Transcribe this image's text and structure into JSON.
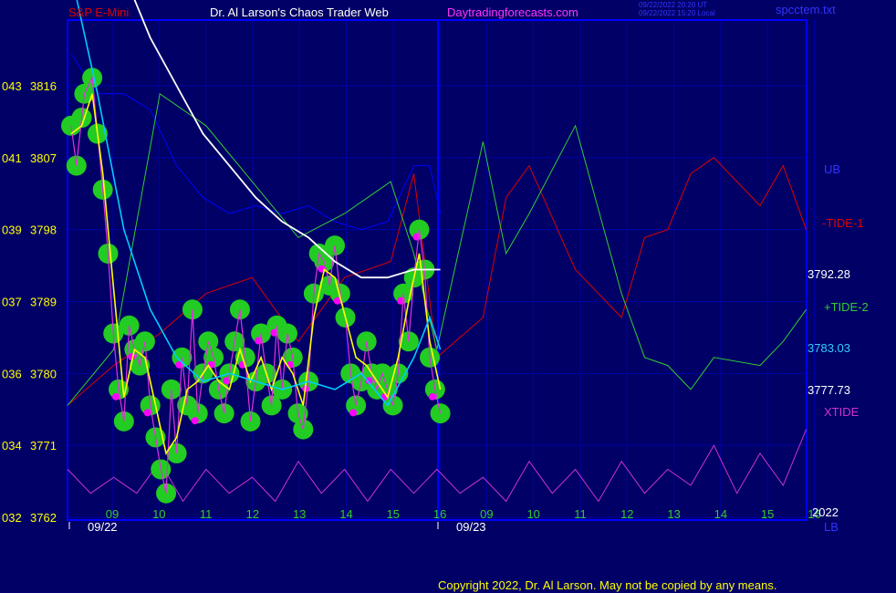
{
  "header": {
    "symbol": "S&P E-Mini",
    "site_title": "Dr. Al Larson's Chaos Trader Web",
    "site_url": "Daytradingforecasts.com",
    "stamp_ut": "09/22/2022 20:20 UT",
    "stamp_local": "09/22/2022 15:20 Local",
    "filename": "spcctem.txt"
  },
  "footer": {
    "copyright": "Copyright 2022, Dr. Al Larson. May not be copied by any means."
  },
  "colors": {
    "background": "#000066",
    "grid": "#0000a8",
    "plot_border": "#0000ff",
    "price_marker_fill": "#22cc22",
    "fast_average": "#ffff00",
    "slow_average": "#00ccff",
    "long_average": "#ffffff",
    "ub": "#0000ff",
    "tide_1": "#dd0000",
    "tide_2": "#33cc33",
    "xtide": "#cc33cc",
    "magenta_dots": "#ff00ff"
  },
  "chart_data": {
    "type": "line",
    "y_axis_labels": [
      {
        "left": "043",
        "right": "3816",
        "value": 3816
      },
      {
        "left": "041",
        "right": "3807",
        "value": 3807
      },
      {
        "left": "039",
        "right": "3798",
        "value": 3798
      },
      {
        "left": "037",
        "right": "3789",
        "value": 3789
      },
      {
        "left": "036",
        "right": "3780",
        "value": 3780
      },
      {
        "left": "034",
        "right": "3771",
        "value": 3771
      },
      {
        "left": "032",
        "right": "3762",
        "value": 3762
      }
    ],
    "ylim": [
      3762,
      3816
    ],
    "x_hour_ticks": [
      "09",
      "10",
      "11",
      "12",
      "13",
      "14",
      "15",
      "16",
      "09",
      "10",
      "11",
      "12",
      "13",
      "14",
      "15",
      "16"
    ],
    "date_labels": [
      "09/22",
      "09/23"
    ],
    "year_label": "2022",
    "right_labels": {
      "ub": "UB",
      "tide_1": "-TIDE-1",
      "level_1": "3792.28",
      "tide_2": "+TIDE-2",
      "level_2": "3783.03",
      "level_3": "3777.73",
      "xtide": "XTIDE",
      "lb": "LB"
    },
    "series": [
      {
        "key": "price",
        "x": [
          0,
          0.1,
          0.2,
          0.25,
          0.4,
          0.5,
          0.6,
          0.7,
          0.8,
          0.9,
          1.0,
          1.1,
          1.2,
          1.3,
          1.4,
          1.5,
          1.6,
          1.7,
          1.8,
          1.9,
          2.0,
          2.1,
          2.2,
          2.3,
          2.4,
          2.5,
          2.6,
          2.7,
          2.8,
          2.9,
          3.0,
          3.1,
          3.2,
          3.3,
          3.4,
          3.5,
          3.6,
          3.7,
          3.8,
          3.9,
          4.0,
          4.1,
          4.2,
          4.3,
          4.4,
          4.5,
          4.6,
          4.7,
          4.8,
          4.9,
          5.0,
          5.1,
          5.2,
          5.3,
          5.4,
          5.5,
          5.6,
          5.7,
          5.8,
          5.9,
          6.0,
          6.1,
          6.2,
          6.3,
          6.4,
          6.5,
          6.6,
          6.7,
          6.8,
          6.9,
          7.0
        ],
        "y": [
          3811,
          3806,
          3812,
          3815,
          3817,
          3810,
          3803,
          3795,
          3785,
          3778,
          3774,
          3786,
          3783,
          3781,
          3784,
          3776,
          3772,
          3768,
          3765,
          3778,
          3770,
          3782,
          3776,
          3788,
          3775,
          3780,
          3784,
          3782,
          3778,
          3775,
          3780,
          3784,
          3788,
          3782,
          3774,
          3779,
          3785,
          3780,
          3776,
          3786,
          3778,
          3785,
          3782,
          3775,
          3773,
          3779,
          3790,
          3795,
          3794,
          3791,
          3796,
          3790,
          3787,
          3780,
          3776,
          3779,
          3784,
          3780,
          3778,
          3780,
          3778,
          3776,
          3780,
          3790,
          3784,
          3792,
          3798,
          3793,
          3782,
          3778,
          3775
        ]
      },
      {
        "key": "fast_average",
        "x": [
          0,
          0.2,
          0.4,
          0.6,
          0.8,
          1.0,
          1.2,
          1.4,
          1.6,
          1.8,
          2.0,
          2.2,
          2.4,
          2.6,
          2.8,
          3.0,
          3.2,
          3.4,
          3.6,
          3.8,
          4.0,
          4.2,
          4.4,
          4.6,
          4.8,
          5.0,
          5.2,
          5.4,
          5.6,
          5.8,
          6.0,
          6.2,
          6.4,
          6.6,
          6.8,
          7.0
        ],
        "y": [
          3810,
          3811,
          3815,
          3805,
          3791,
          3777,
          3783,
          3782,
          3776,
          3770,
          3772,
          3778,
          3779,
          3781,
          3779,
          3778,
          3783,
          3779,
          3782,
          3778,
          3782,
          3780,
          3776,
          3787,
          3793,
          3792,
          3787,
          3782,
          3781,
          3779,
          3777,
          3782,
          3789,
          3795,
          3784,
          3778
        ]
      },
      {
        "key": "slow_average",
        "x": [
          0.0,
          0.5,
          1.0,
          1.5,
          2.0,
          2.5,
          3.0,
          3.5,
          4.0,
          4.5,
          5.0,
          5.5,
          6.0,
          6.5,
          6.8,
          7.0
        ],
        "y": [
          3830,
          3815,
          3798,
          3788,
          3782,
          3779,
          3780,
          3779,
          3778,
          3779,
          3778,
          3780,
          3776,
          3782,
          3787,
          3783
        ]
      },
      {
        "key": "long_average",
        "x": [
          0.0,
          0.5,
          1.0,
          1.5,
          2.0,
          2.5,
          3.0,
          3.5,
          4.0,
          4.5,
          5.0,
          5.5,
          6.0,
          6.5,
          7.0
        ],
        "y": [
          3850,
          3840,
          3830,
          3822,
          3816,
          3810,
          3806,
          3802,
          3799,
          3797,
          3794,
          3792,
          3792,
          3793,
          3793
        ]
      },
      {
        "key": "ub",
        "x": [
          0,
          0.5,
          1.0,
          1.5,
          2.0,
          2.5,
          3.0,
          3.5,
          4.0,
          4.5,
          5.0,
          5.5,
          6.0,
          6.5,
          6.8,
          7.0
        ],
        "y": [
          3820,
          3815,
          3815,
          3813,
          3806,
          3802,
          3800,
          3801,
          3800,
          3801,
          3799,
          3798,
          3799,
          3806,
          3806,
          3800
        ]
      },
      {
        "key": "tide_1",
        "x": [
          0,
          1,
          2,
          3,
          4,
          5,
          6,
          7,
          7.5,
          8,
          9,
          9.5,
          10,
          11,
          12,
          12.5,
          13,
          13.5,
          14,
          15,
          15.5,
          16
        ],
        "y": [
          3776,
          3781,
          3785,
          3790,
          3792,
          3784,
          3792,
          3794,
          3805,
          3782,
          3787,
          3802,
          3806,
          3793,
          3787,
          3797,
          3798,
          3805,
          3807,
          3801,
          3806,
          3798
        ]
      },
      {
        "key": "tide_2",
        "x": [
          0,
          1,
          2,
          3,
          4,
          5,
          6,
          7,
          7.5,
          8,
          9,
          9.5,
          10,
          11,
          12,
          12.5,
          13,
          13.5,
          14,
          15,
          15.5,
          16
        ],
        "y": [
          3776,
          3783,
          3815,
          3811,
          3804,
          3797,
          3800,
          3804,
          3795,
          3783,
          3809,
          3795,
          3800,
          3811,
          3790,
          3782,
          3781,
          3778,
          3782,
          3781,
          3784,
          3788
        ]
      },
      {
        "key": "xtide",
        "x": [
          0,
          0.5,
          1.0,
          1.5,
          2.0,
          2.5,
          3.0,
          3.5,
          4.0,
          4.5,
          5.0,
          5.5,
          6.0,
          6.5,
          7.0,
          7.5,
          8.0,
          8.5,
          9.0,
          9.5,
          10.0,
          10.5,
          11.0,
          11.5,
          12.0,
          12.5,
          13.0,
          13.5,
          14.0,
          14.5,
          15.0,
          15.5,
          16.0
        ],
        "y": [
          3768,
          3765,
          3767,
          3765,
          3769,
          3764,
          3768,
          3765,
          3767,
          3764,
          3769,
          3765,
          3768,
          3764,
          3768,
          3765,
          3768,
          3765,
          3767,
          3764,
          3769,
          3765,
          3768,
          3764,
          3769,
          3765,
          3768,
          3766,
          3771,
          3765,
          3770,
          3766,
          3773
        ]
      }
    ]
  }
}
